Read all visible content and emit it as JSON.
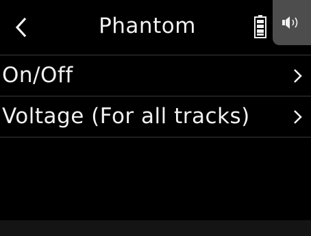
{
  "header": {
    "title": "Phantom",
    "back_icon": "chevron-left-icon",
    "battery_icon": "battery-icon",
    "speaker_icon": "speaker-icon"
  },
  "menu": {
    "items": [
      {
        "label": "On/Off",
        "icon": "chevron-right-icon"
      },
      {
        "label": "Voltage (For all tracks)",
        "icon": "chevron-right-icon"
      }
    ]
  },
  "colors": {
    "background": "#000000",
    "text": "#f2f2f2",
    "divider": "#3a3a3a",
    "speaker_tab": "#4d4d4d",
    "footer": "#141414"
  }
}
